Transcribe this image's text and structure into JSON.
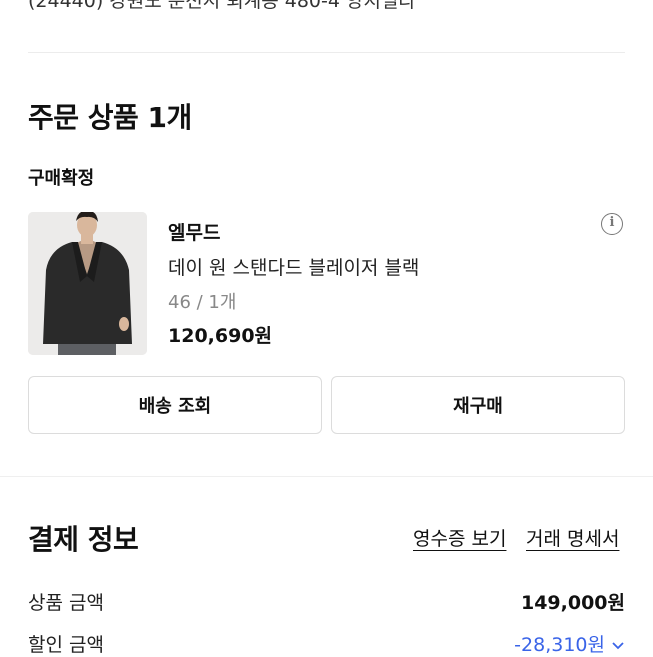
{
  "address": "(24440) 강원도 춘천시 퇴계동 480-4 양지빌라",
  "order": {
    "title": "주문 상품 1개",
    "status": "구매확정",
    "item": {
      "brand": "엘무드",
      "name": "데이 원 스탠다드 블레이저 블랙",
      "option": "46 / 1개",
      "price": "120,690원"
    },
    "buttons": {
      "shipping": "배송 조회",
      "reorder": "재구매"
    }
  },
  "payment": {
    "title": "결제 정보",
    "receipt_link": "영수증 보기",
    "statement_link": "거래 명세서",
    "rows": [
      {
        "label": "상품 금액",
        "value": "149,000원"
      },
      {
        "label": "할인 금액",
        "value": "-28,310원"
      }
    ]
  },
  "colors": {
    "discount": "#3a64e8",
    "divider": "#ececec"
  },
  "icons": [
    "info-icon",
    "chevron-down-icon"
  ]
}
